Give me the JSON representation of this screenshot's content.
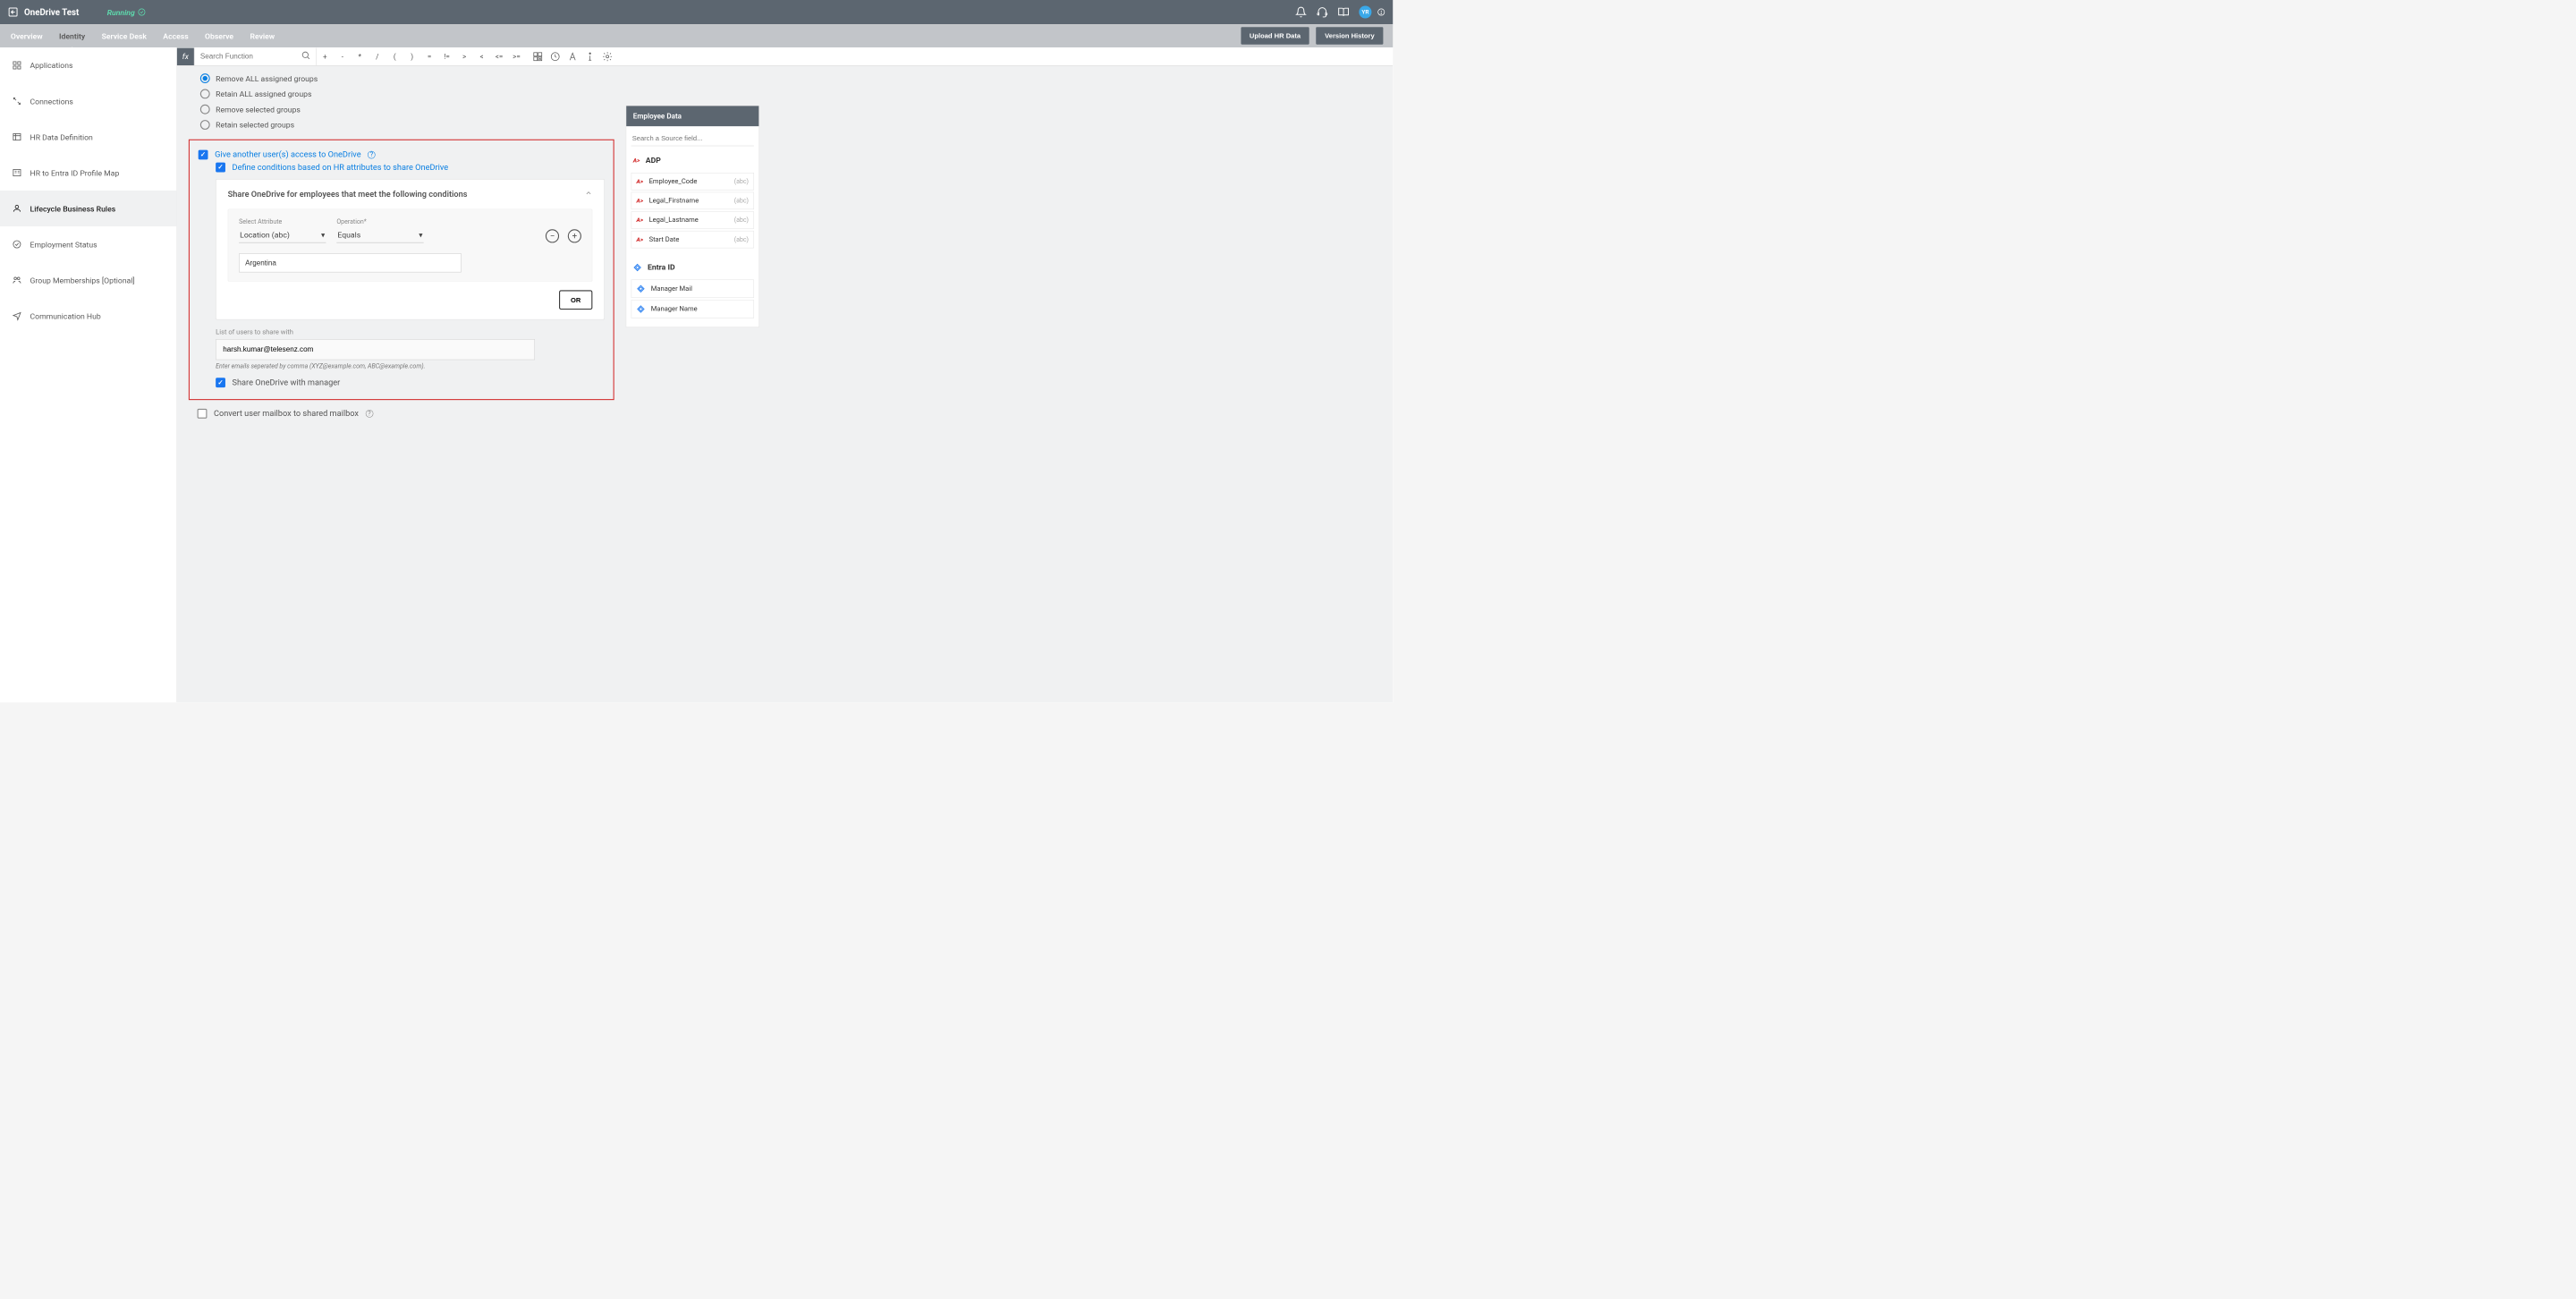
{
  "header": {
    "title": "OneDrive Test",
    "status": "Running",
    "avatar": "YR"
  },
  "tabs": {
    "items": [
      "Overview",
      "Identity",
      "Service Desk",
      "Access",
      "Observe",
      "Review"
    ],
    "active": 1,
    "upload_btn": "Upload HR Data",
    "version_btn": "Version History"
  },
  "sidebar": {
    "items": [
      {
        "label": "Applications"
      },
      {
        "label": "Connections"
      },
      {
        "label": "HR Data Definition"
      },
      {
        "label": "HR to Entra ID Profile Map"
      },
      {
        "label": "Lifecycle Business Rules"
      },
      {
        "label": "Employment Status"
      },
      {
        "label": "Group Memberships [Optional]"
      },
      {
        "label": "Communication Hub"
      }
    ],
    "active": 4
  },
  "formula": {
    "fx": "fx",
    "search_placeholder": "Search Function",
    "ops": [
      "+",
      "-",
      "*",
      "/",
      "(",
      ")",
      "=",
      "!=",
      ">",
      "<",
      "<=",
      ">="
    ]
  },
  "radios": {
    "options": [
      "Remove ALL assigned groups",
      "Retain ALL assigned groups",
      "Remove selected groups",
      "Retain selected groups"
    ],
    "selected": 0
  },
  "access": {
    "give_access_label": "Give another user(s) access to OneDrive",
    "define_cond_label": "Define conditions based on HR attributes to share OneDrive",
    "cond_panel_title": "Share OneDrive for employees that meet the following conditions",
    "attr_label": "Select Attribute",
    "attr_value": "Location (abc)",
    "op_label": "Operation*",
    "op_value": "Equals",
    "value_input": "Argentina",
    "or_btn": "OR",
    "list_label": "List of users to share with",
    "email_value": "harsh.kumar@telesenz.com",
    "hint": "Enter emails seperated by comma (XYZ@example.com, ABC@example.com).",
    "share_mgr_label": "Share OneDrive with manager",
    "convert_label": "Convert user mailbox to shared mailbox"
  },
  "employee_data": {
    "title": "Employee Data",
    "search_placeholder": "Search a Source field...",
    "providers": [
      {
        "name": "ADP",
        "kind": "adp",
        "fields": [
          {
            "name": "Employee_Code",
            "type": "(abc)"
          },
          {
            "name": "Legal_Firstname",
            "type": "(abc)"
          },
          {
            "name": "Legal_Lastname",
            "type": "(abc)"
          },
          {
            "name": "Start Date",
            "type": "(abc)"
          }
        ]
      },
      {
        "name": "Entra ID",
        "kind": "entra",
        "fields": [
          {
            "name": "Manager Mail",
            "type": ""
          },
          {
            "name": "Manager Name",
            "type": ""
          }
        ]
      }
    ]
  }
}
